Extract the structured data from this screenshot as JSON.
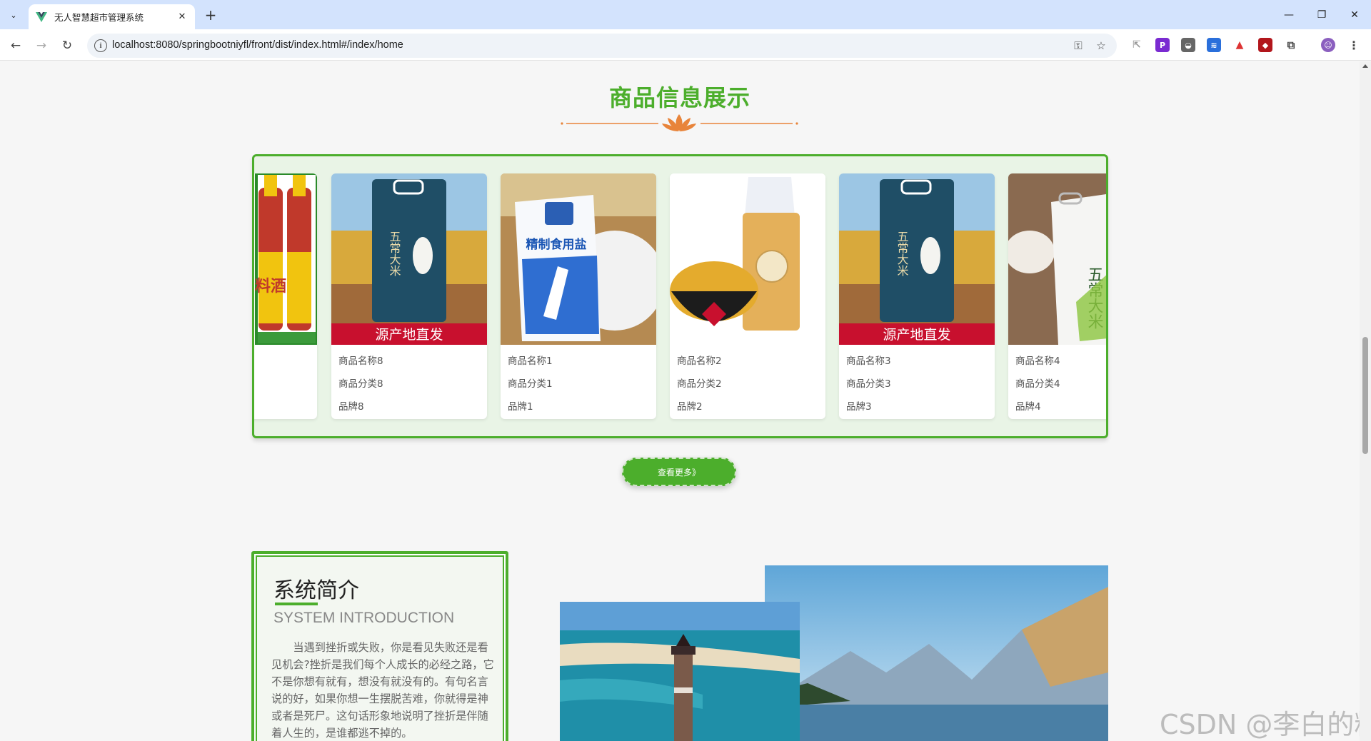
{
  "browser": {
    "tab_title": "无人智慧超市管理系统",
    "url": "localhost:8080/springbootniyfl/front/dist/index.html#/index/home"
  },
  "page": {
    "section_title": "商品信息展示",
    "more_button": "查看更多》",
    "products": [
      {
        "name": "商品名称8",
        "category": "商品分类8",
        "brand": "品牌8",
        "image": "rice-bag"
      },
      {
        "name": "商品名称1",
        "category": "商品分类1",
        "brand": "品牌1",
        "image": "salt-bag"
      },
      {
        "name": "商品名称2",
        "category": "商品分类2",
        "brand": "品牌2",
        "image": "millet"
      },
      {
        "name": "商品名称3",
        "category": "商品分类3",
        "brand": "品牌3",
        "image": "rice-bag"
      },
      {
        "name": "商品名称4",
        "category": "商品分类4",
        "brand": "品牌4",
        "image": "rice-sack"
      }
    ],
    "product_labels": {
      "banner": "源产地直发",
      "rice_name": "五常大米",
      "salt_name": "精制食用盐",
      "bottle_label": "料酒"
    },
    "intro": {
      "title": "系统简介",
      "subtitle": "SYSTEM INTRODUCTION",
      "text": "当遇到挫折或失败，你是看见失败还是看见机会?挫折是我们每个人成长的必经之路，它不是你想有就有，想没有就没有的。有句名言说的好，如果你想一生摆脱苦难，你就得是神或者是死尸。这句话形象地说明了挫折是伴随着人生的，是谁都逃不掉的。"
    },
    "watermark": "CSDN @李白的粉"
  },
  "colors": {
    "accent_green": "#4cae2c",
    "divider_orange": "#e8843a",
    "tab_strip": "#d3e3fd"
  }
}
